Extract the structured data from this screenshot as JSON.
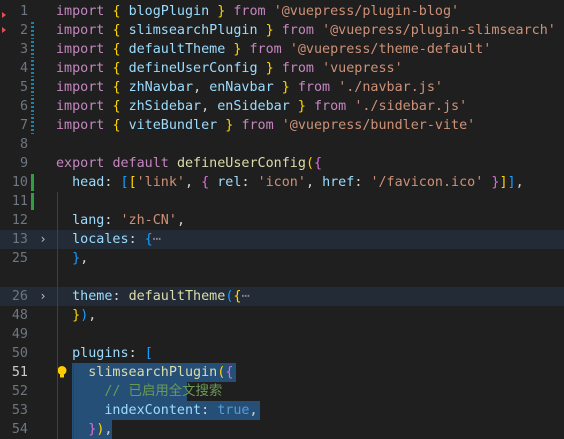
{
  "editor": {
    "language": "javascript",
    "active_line": 51,
    "lines": [
      {
        "num": "1",
        "mark": "",
        "fold": "",
        "tokens": [
          [
            "import ",
            "kw2"
          ],
          [
            "{ ",
            "br1"
          ],
          [
            "blogPlugin",
            "id"
          ],
          [
            " } ",
            "br1"
          ],
          [
            "from ",
            "kw2"
          ],
          [
            "'@vuepress/plugin-blog'",
            "str"
          ]
        ]
      },
      {
        "num": "2",
        "mark": "mod",
        "fold": "",
        "tokens": [
          [
            "import ",
            "kw2"
          ],
          [
            "{ ",
            "br1"
          ],
          [
            "slimsearchPlugin",
            "id"
          ],
          [
            " } ",
            "br1"
          ],
          [
            "from ",
            "kw2"
          ],
          [
            "'@vuepress/plugin-slimsearch'",
            "str"
          ]
        ]
      },
      {
        "num": "3",
        "mark": "mod",
        "fold": "",
        "tokens": [
          [
            "import ",
            "kw2"
          ],
          [
            "{ ",
            "br1"
          ],
          [
            "defaultTheme",
            "id"
          ],
          [
            " } ",
            "br1"
          ],
          [
            "from ",
            "kw2"
          ],
          [
            "'@vuepress/theme-default'",
            "str"
          ]
        ]
      },
      {
        "num": "4",
        "mark": "mod",
        "fold": "",
        "tokens": [
          [
            "import ",
            "kw2"
          ],
          [
            "{ ",
            "br1"
          ],
          [
            "defineUserConfig",
            "id"
          ],
          [
            " } ",
            "br1"
          ],
          [
            "from ",
            "kw2"
          ],
          [
            "'vuepress'",
            "str"
          ]
        ]
      },
      {
        "num": "5",
        "mark": "mod",
        "fold": "",
        "tokens": [
          [
            "import ",
            "kw2"
          ],
          [
            "{ ",
            "br1"
          ],
          [
            "zhNavbar",
            "id"
          ],
          [
            ", ",
            "pl"
          ],
          [
            "enNavbar",
            "id"
          ],
          [
            " } ",
            "br1"
          ],
          [
            "from ",
            "kw2"
          ],
          [
            "'./navbar.js'",
            "str"
          ]
        ]
      },
      {
        "num": "6",
        "mark": "mod",
        "fold": "",
        "tokens": [
          [
            "import ",
            "kw2"
          ],
          [
            "{ ",
            "br1"
          ],
          [
            "zhSidebar",
            "id"
          ],
          [
            ", ",
            "pl"
          ],
          [
            "enSidebar",
            "id"
          ],
          [
            " } ",
            "br1"
          ],
          [
            "from ",
            "kw2"
          ],
          [
            "'./sidebar.js'",
            "str"
          ]
        ]
      },
      {
        "num": "7",
        "mark": "mod",
        "fold": "",
        "tokens": [
          [
            "import ",
            "kw2"
          ],
          [
            "{ ",
            "br1"
          ],
          [
            "viteBundler",
            "id"
          ],
          [
            " } ",
            "br1"
          ],
          [
            "from ",
            "kw2"
          ],
          [
            "'@vuepress/bundler-vite'",
            "str"
          ]
        ]
      },
      {
        "num": "8",
        "mark": "",
        "fold": "",
        "tokens": []
      },
      {
        "num": "9",
        "mark": "",
        "fold": "",
        "tokens": [
          [
            "export ",
            "kw2"
          ],
          [
            "default ",
            "kw2"
          ],
          [
            "defineUserConfig",
            "fn"
          ],
          [
            "(",
            "br1"
          ],
          [
            "{",
            "br2"
          ]
        ]
      },
      {
        "num": "10",
        "mark": "add",
        "fold": "",
        "tokens": [
          [
            "  ",
            "pl"
          ],
          [
            "head",
            "id"
          ],
          [
            ": ",
            "pl"
          ],
          [
            "[",
            "br3"
          ],
          [
            "[",
            "br1"
          ],
          [
            "'link'",
            "str"
          ],
          [
            ", ",
            "pl"
          ],
          [
            "{ ",
            "br2"
          ],
          [
            "rel",
            "id"
          ],
          [
            ": ",
            "pl"
          ],
          [
            "'icon'",
            "str"
          ],
          [
            ", ",
            "pl"
          ],
          [
            "href",
            "id"
          ],
          [
            ": ",
            "pl"
          ],
          [
            "'/favicon.ico'",
            "str"
          ],
          [
            " }",
            "br2"
          ],
          [
            "]",
            "br1"
          ],
          [
            "]",
            "br3"
          ],
          [
            ",",
            "pl"
          ]
        ]
      },
      {
        "num": "11",
        "mark": "add",
        "fold": "",
        "tokens": []
      },
      {
        "num": "12",
        "mark": "",
        "fold": "",
        "tokens": [
          [
            "  ",
            "pl"
          ],
          [
            "lang",
            "id"
          ],
          [
            ": ",
            "pl"
          ],
          [
            "'zh-CN'",
            "str"
          ],
          [
            ",",
            "pl"
          ]
        ]
      },
      {
        "num": "13",
        "mark": "",
        "fold": "›",
        "folded": true,
        "tokens": [
          [
            "  ",
            "pl"
          ],
          [
            "locales",
            "id"
          ],
          [
            ": ",
            "pl"
          ],
          [
            "{",
            "br3"
          ],
          [
            "⋯",
            "ell"
          ]
        ]
      },
      {
        "num": "25",
        "mark": "",
        "fold": "",
        "tokens": [
          [
            "  ",
            "pl"
          ],
          [
            "}",
            "br3"
          ],
          [
            ",",
            "pl"
          ]
        ]
      },
      {
        "num": "",
        "mark": "",
        "fold": "",
        "tokens": []
      },
      {
        "num": "26",
        "mark": "",
        "fold": "›",
        "folded": true,
        "tokens": [
          [
            "  ",
            "pl"
          ],
          [
            "theme",
            "id"
          ],
          [
            ": ",
            "pl"
          ],
          [
            "defaultTheme",
            "fn"
          ],
          [
            "(",
            "br3"
          ],
          [
            "{",
            "br1"
          ],
          [
            "⋯",
            "ell"
          ]
        ]
      },
      {
        "num": "48",
        "mark": "",
        "fold": "",
        "tokens": [
          [
            "  ",
            "pl"
          ],
          [
            "}",
            "br1"
          ],
          [
            ")",
            "br3"
          ],
          [
            ",",
            "pl"
          ]
        ]
      },
      {
        "num": "49",
        "mark": "",
        "fold": "",
        "tokens": []
      },
      {
        "num": "50",
        "mark": "",
        "fold": "",
        "tokens": [
          [
            "  ",
            "pl"
          ],
          [
            "plugins",
            "id"
          ],
          [
            ": ",
            "pl"
          ],
          [
            "[",
            "br3"
          ]
        ]
      },
      {
        "num": "51",
        "mark": "",
        "fold": "",
        "bulb": true,
        "sel": [
          2,
          null
        ],
        "tokens": [
          [
            "    ",
            "pl"
          ],
          [
            "slimsearchPlugin",
            "fn"
          ],
          [
            "(",
            "br1"
          ],
          [
            "{",
            "br2"
          ]
        ]
      },
      {
        "num": "52",
        "mark": "",
        "fold": "",
        "sel": [
          2,
          null
        ],
        "tokens": [
          [
            "      ",
            "pl"
          ],
          [
            "// 已启用全文搜索",
            "cm"
          ]
        ]
      },
      {
        "num": "53",
        "mark": "",
        "fold": "",
        "sel": [
          2,
          null
        ],
        "tokens": [
          [
            "      ",
            "pl"
          ],
          [
            "indexContent",
            "id"
          ],
          [
            ": ",
            "pl"
          ],
          [
            "true",
            "kw"
          ],
          [
            ",",
            "pl"
          ]
        ]
      },
      {
        "num": "54",
        "mark": "",
        "fold": "",
        "sel": [
          2,
          7
        ],
        "tokens": [
          [
            "    ",
            "pl"
          ],
          [
            "}",
            "br2"
          ],
          [
            ")",
            "br1"
          ],
          [
            ",",
            "pl"
          ]
        ]
      }
    ]
  },
  "icons": {
    "fold": "chevron-right-icon",
    "bulb": "lightbulb-icon",
    "error_marker": "error-triangle-icon"
  },
  "colors": {
    "background": "#1f1f1f",
    "selection": "#264f78",
    "folded_line": "#232b36",
    "modified_marker": "#1b81a8",
    "added_marker": "#2ea043"
  }
}
